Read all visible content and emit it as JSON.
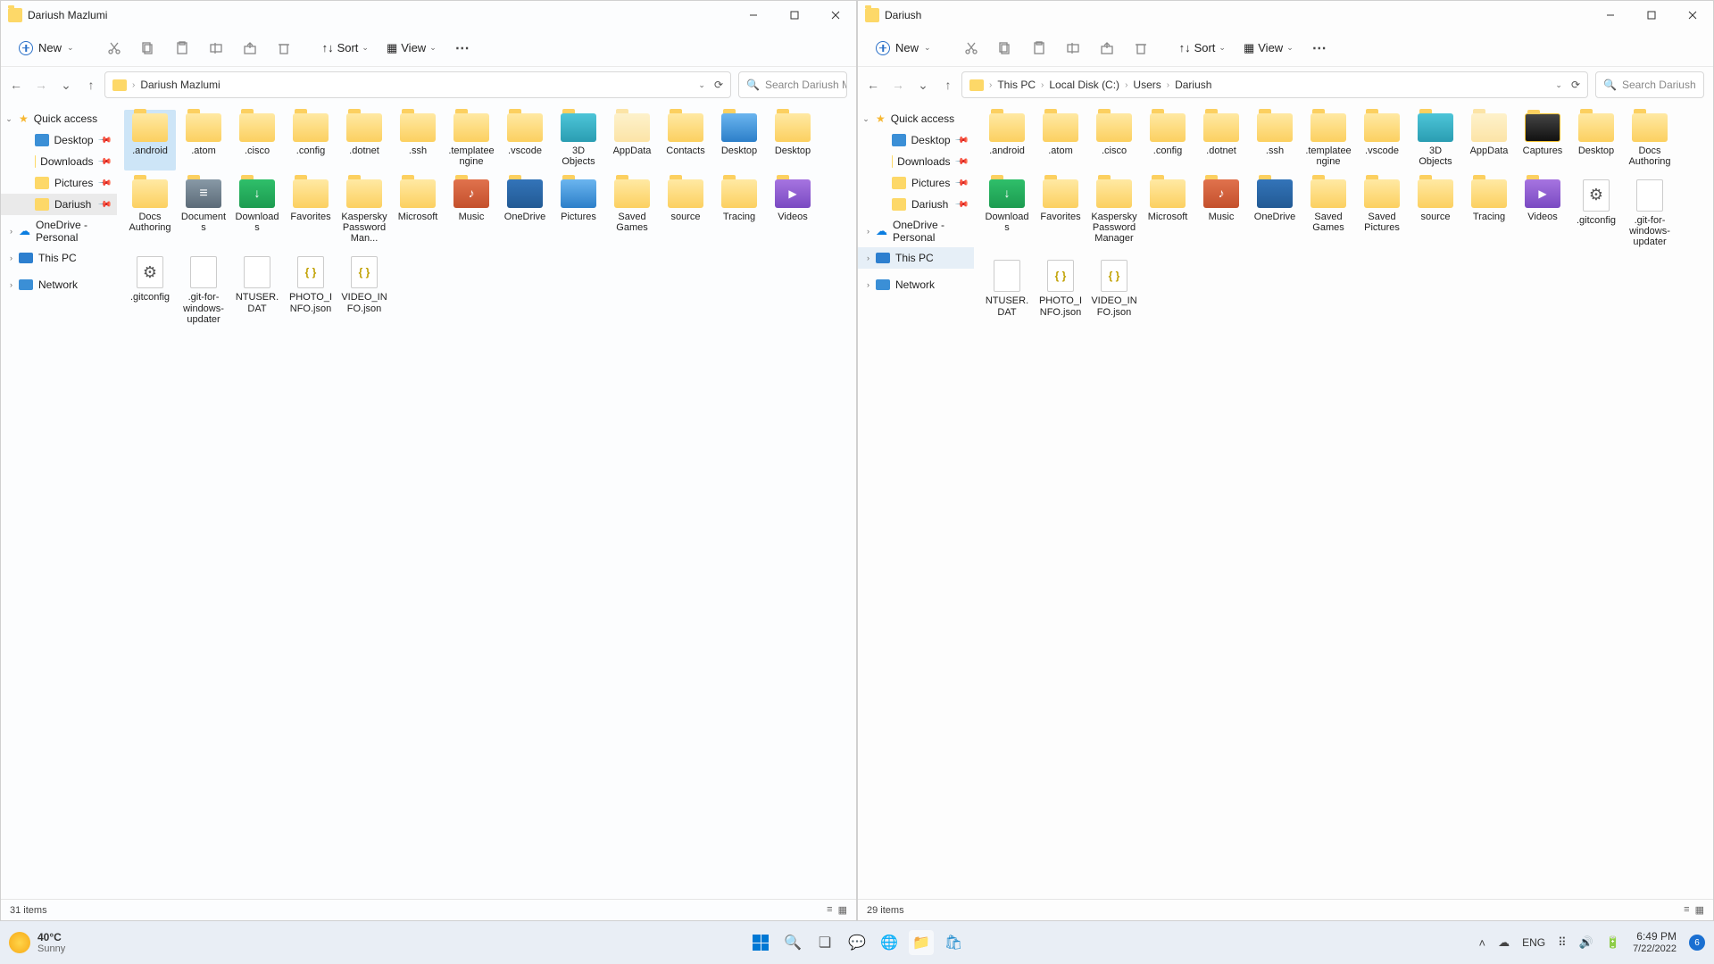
{
  "windows": [
    {
      "title": "Dariush Mazlumi",
      "toolbar": {
        "new": "New",
        "sort": "Sort",
        "view": "View"
      },
      "breadcrumb": [
        "Dariush Mazlumi"
      ],
      "search_placeholder": "Search Dariush M...",
      "sidebar": {
        "quick_access": "Quick access",
        "items": [
          {
            "label": "Desktop",
            "pinned": true
          },
          {
            "label": "Downloads",
            "pinned": true
          },
          {
            "label": "Pictures",
            "pinned": true
          },
          {
            "label": "Dariush",
            "pinned": true,
            "hl": true
          }
        ],
        "onedrive": "OneDrive - Personal",
        "thispc": "This PC",
        "network": "Network"
      },
      "items": [
        {
          "label": ".android",
          "type": "folder",
          "sel": true
        },
        {
          "label": ".atom",
          "type": "folder"
        },
        {
          "label": ".cisco",
          "type": "folder"
        },
        {
          "label": ".config",
          "type": "folder"
        },
        {
          "label": ".dotnet",
          "type": "folder"
        },
        {
          "label": ".ssh",
          "type": "folder"
        },
        {
          "label": ".templateengine",
          "type": "folder"
        },
        {
          "label": ".vscode",
          "type": "folder"
        },
        {
          "label": "3D Objects",
          "type": "folder-teal"
        },
        {
          "label": "AppData",
          "type": "folder-hidden"
        },
        {
          "label": "Contacts",
          "type": "folder"
        },
        {
          "label": "Desktop",
          "type": "folder-blue"
        },
        {
          "label": "Desktop",
          "type": "folder"
        },
        {
          "label": "Docs Authoring",
          "type": "folder"
        },
        {
          "label": "Documents",
          "type": "folder-docs"
        },
        {
          "label": "Downloads",
          "type": "folder-green"
        },
        {
          "label": "Favorites",
          "type": "folder"
        },
        {
          "label": "Kaspersky Password Man...",
          "type": "folder"
        },
        {
          "label": "Microsoft",
          "type": "folder"
        },
        {
          "label": "Music",
          "type": "folder-music"
        },
        {
          "label": "OneDrive",
          "type": "folder-dark"
        },
        {
          "label": "Pictures",
          "type": "folder-blue"
        },
        {
          "label": "Saved Games",
          "type": "folder"
        },
        {
          "label": "source",
          "type": "folder"
        },
        {
          "label": "Tracing",
          "type": "folder"
        },
        {
          "label": "Videos",
          "type": "folder-video"
        },
        {
          "label": ".gitconfig",
          "type": "gear"
        },
        {
          "label": ".git-for-windows-updater",
          "type": "file"
        },
        {
          "label": "NTUSER.DAT",
          "type": "file"
        },
        {
          "label": "PHOTO_INFO.json",
          "type": "json"
        },
        {
          "label": "VIDEO_INFO.json",
          "type": "json"
        }
      ],
      "status": "31 items"
    },
    {
      "title": "Dariush",
      "toolbar": {
        "new": "New",
        "sort": "Sort",
        "view": "View"
      },
      "breadcrumb": [
        "This PC",
        "Local Disk (C:)",
        "Users",
        "Dariush"
      ],
      "search_placeholder": "Search Dariush",
      "sidebar": {
        "quick_access": "Quick access",
        "items": [
          {
            "label": "Desktop",
            "pinned": true
          },
          {
            "label": "Downloads",
            "pinned": true
          },
          {
            "label": "Pictures",
            "pinned": true
          },
          {
            "label": "Dariush",
            "pinned": true
          }
        ],
        "onedrive": "OneDrive - Personal",
        "thispc": "This PC",
        "thispc_sel": true,
        "network": "Network"
      },
      "items": [
        {
          "label": ".android",
          "type": "folder"
        },
        {
          "label": ".atom",
          "type": "folder"
        },
        {
          "label": ".cisco",
          "type": "folder"
        },
        {
          "label": ".config",
          "type": "folder"
        },
        {
          "label": ".dotnet",
          "type": "folder"
        },
        {
          "label": ".ssh",
          "type": "folder"
        },
        {
          "label": ".templateengine",
          "type": "folder"
        },
        {
          "label": ".vscode",
          "type": "folder"
        },
        {
          "label": "3D Objects",
          "type": "folder-teal"
        },
        {
          "label": "AppData",
          "type": "folder-hidden"
        },
        {
          "label": "Captures",
          "type": "folder-black"
        },
        {
          "label": "Desktop",
          "type": "folder"
        },
        {
          "label": "Docs Authoring",
          "type": "folder"
        },
        {
          "label": "Downloads",
          "type": "folder-green"
        },
        {
          "label": "Favorites",
          "type": "folder"
        },
        {
          "label": "Kaspersky Password Manager",
          "type": "folder"
        },
        {
          "label": "Microsoft",
          "type": "folder"
        },
        {
          "label": "Music",
          "type": "folder-music"
        },
        {
          "label": "OneDrive",
          "type": "folder-dark"
        },
        {
          "label": "Saved Games",
          "type": "folder"
        },
        {
          "label": "Saved Pictures",
          "type": "folder"
        },
        {
          "label": "source",
          "type": "folder"
        },
        {
          "label": "Tracing",
          "type": "folder"
        },
        {
          "label": "Videos",
          "type": "folder-video"
        },
        {
          "label": ".gitconfig",
          "type": "gear"
        },
        {
          "label": ".git-for-windows-updater",
          "type": "file"
        },
        {
          "label": "NTUSER.DAT",
          "type": "file"
        },
        {
          "label": "PHOTO_INFO.json",
          "type": "json"
        },
        {
          "label": "VIDEO_INFO.json",
          "type": "json"
        }
      ],
      "status": "29 items"
    }
  ],
  "taskbar": {
    "weather_temp": "40°C",
    "weather_desc": "Sunny",
    "lang": "ENG",
    "time": "6:49 PM",
    "date": "7/22/2022",
    "notif_count": "6"
  }
}
